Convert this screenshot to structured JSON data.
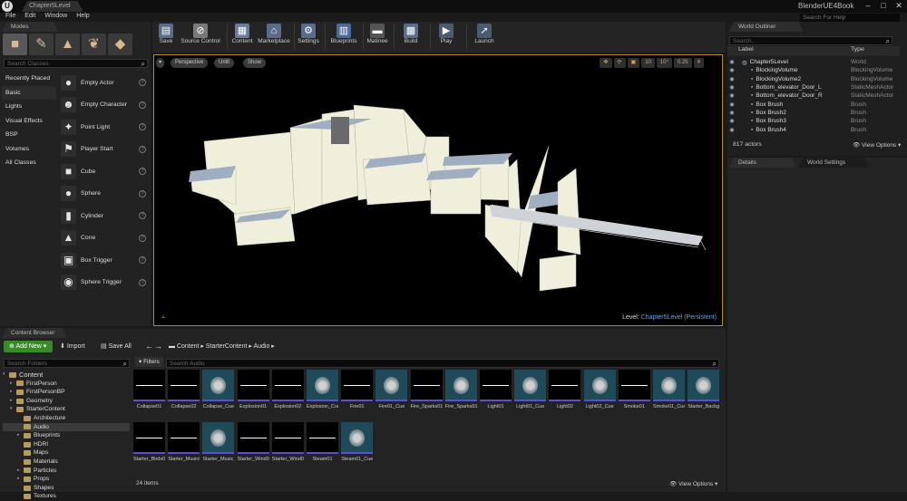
{
  "window": {
    "doc_tab": "Chapter5Level",
    "app_title": "BlenderUE4Book",
    "help_search": "Search For Help"
  },
  "menu": [
    "File",
    "Edit",
    "Window",
    "Help"
  ],
  "modes": {
    "tab": "Modes",
    "search_placeholder": "Search Classes",
    "categories": [
      "Recently Placed",
      "Basic",
      "Lights",
      "Visual Effects",
      "BSP",
      "Volumes",
      "All Classes"
    ],
    "actors": [
      "Empty Actor",
      "Empty Character",
      "Point Light",
      "Player Start",
      "Cube",
      "Sphere",
      "Cylinder",
      "Cone",
      "Box Trigger",
      "Sphere Trigger"
    ]
  },
  "toolbar": [
    {
      "label": "Save",
      "icon": "save-icon"
    },
    {
      "label": "Source Control",
      "icon": "source-control-icon"
    },
    {
      "label": "Content",
      "icon": "content-icon"
    },
    {
      "label": "Marketplace",
      "icon": "marketplace-icon"
    },
    {
      "label": "Settings",
      "icon": "settings-icon"
    },
    {
      "label": "Blueprints",
      "icon": "blueprints-icon"
    },
    {
      "label": "Matinee",
      "icon": "matinee-icon"
    },
    {
      "label": "Build",
      "icon": "build-icon"
    },
    {
      "label": "Play",
      "icon": "play-icon"
    },
    {
      "label": "Launch",
      "icon": "launch-icon"
    }
  ],
  "viewport": {
    "perspective": "Perspective",
    "unlit": "Unlit",
    "show": "Show",
    "right_controls": [
      "10",
      "10°",
      "0.25",
      "4"
    ],
    "level_label": "Level:",
    "level_name": "Chapter5Level (Persistent)"
  },
  "outliner": {
    "tab": "World Outliner",
    "search_placeholder": "Search...",
    "col_label": "Label",
    "col_type": "Type",
    "rows": [
      {
        "name": "Chapter5Level",
        "type": "World"
      },
      {
        "name": "BlockingVolume",
        "type": "BlockingVolume"
      },
      {
        "name": "BlockingVolume2",
        "type": "BlockingVolume"
      },
      {
        "name": "Bottom_elevator_Door_L",
        "type": "StaticMeshActor"
      },
      {
        "name": "Bottom_elevator_Door_R",
        "type": "StaticMeshActor"
      },
      {
        "name": "Box Brush",
        "type": "Brush"
      },
      {
        "name": "Box Brush2",
        "type": "Brush"
      },
      {
        "name": "Box Brush3",
        "type": "Brush"
      },
      {
        "name": "Box Brush4",
        "type": "Brush"
      }
    ],
    "count": "817 actors",
    "view_options": "View Options"
  },
  "details": {
    "tab": "Details",
    "world_settings_tab": "World Settings"
  },
  "content_browser": {
    "tab": "Content Browser",
    "add_new": "Add New",
    "import": "Import",
    "save_all": "Save All",
    "breadcrumb": [
      "Content",
      "StarterContent",
      "Audio"
    ],
    "folder_search": "Search Folders",
    "asset_search": "Search Audio",
    "filters": "Filters",
    "folders": [
      {
        "name": "Content",
        "level": 0,
        "open": true
      },
      {
        "name": "FirstPerson",
        "level": 1
      },
      {
        "name": "FirstPersonBP",
        "level": 1
      },
      {
        "name": "Geometry",
        "level": 1
      },
      {
        "name": "StarterContent",
        "level": 1,
        "open": true
      },
      {
        "name": "Architecture",
        "level": 2
      },
      {
        "name": "Audio",
        "level": 2,
        "selected": true
      },
      {
        "name": "Blueprints",
        "level": 2
      },
      {
        "name": "HDRI",
        "level": 2
      },
      {
        "name": "Maps",
        "level": 2
      },
      {
        "name": "Materials",
        "level": 2
      },
      {
        "name": "Particles",
        "level": 2
      },
      {
        "name": "Props",
        "level": 2
      },
      {
        "name": "Shapes",
        "level": 2
      },
      {
        "name": "Textures",
        "level": 2
      }
    ],
    "assets": [
      {
        "name": "Collapse01",
        "kind": "wave"
      },
      {
        "name": "Collapse02",
        "kind": "wave"
      },
      {
        "name": "Collapse_Cue",
        "kind": "cue"
      },
      {
        "name": "Explosion01",
        "kind": "wave"
      },
      {
        "name": "Explosion02",
        "kind": "wave"
      },
      {
        "name": "Explosion_Cue",
        "kind": "cue"
      },
      {
        "name": "Fire01",
        "kind": "wave"
      },
      {
        "name": "Fire01_Cue",
        "kind": "cue"
      },
      {
        "name": "Fire_Sparks01",
        "kind": "wave"
      },
      {
        "name": "Fire_Sparks01_Cue",
        "kind": "cue"
      },
      {
        "name": "Light01",
        "kind": "wave"
      },
      {
        "name": "Light01_Cue",
        "kind": "cue"
      },
      {
        "name": "Light02",
        "kind": "wave"
      },
      {
        "name": "Light02_Cue",
        "kind": "cue"
      },
      {
        "name": "Smoke01",
        "kind": "wave"
      },
      {
        "name": "Smoke01_Cue",
        "kind": "cue"
      },
      {
        "name": "Starter_Background_Cue",
        "kind": "cue"
      },
      {
        "name": "Starter_Birds01",
        "kind": "wave"
      },
      {
        "name": "Starter_Music01",
        "kind": "wave"
      },
      {
        "name": "Starter_Music_Cue",
        "kind": "cue"
      },
      {
        "name": "Starter_Wind05",
        "kind": "wave"
      },
      {
        "name": "Starter_Wind06",
        "kind": "wave"
      },
      {
        "name": "Steam01",
        "kind": "wave"
      },
      {
        "name": "Steam01_Cue",
        "kind": "cue"
      }
    ],
    "item_count": "24 items",
    "view_options": "View Options"
  }
}
